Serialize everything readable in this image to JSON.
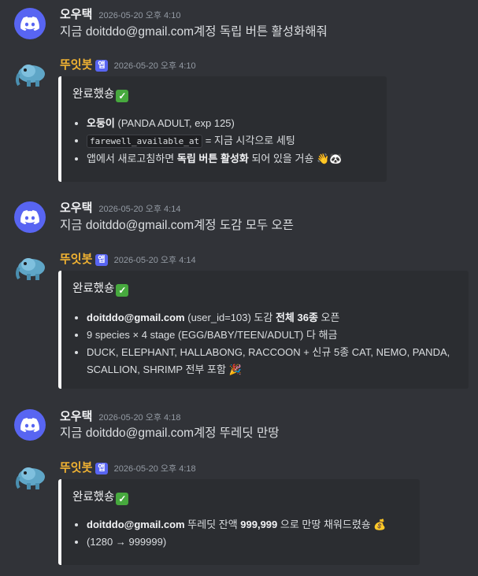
{
  "messages": [
    {
      "author": "오우택",
      "time": "2026-05-20 오후 4:10",
      "text": "지금 doitddo@gmail.com계정 독립 버튼 활성화해줘"
    },
    {
      "author": "뚜잇봇",
      "badge": "앱",
      "time": "2026-05-20 오후 4:10",
      "embed": {
        "title": "완료했숑",
        "items": [
          {
            "bold": "오둥이",
            "rest": " (PANDA ADULT, exp 125)"
          },
          {
            "code": "farewell_available_at",
            "rest": " = 지금 시각으로 세팅"
          },
          {
            "pre": "앱에서 새로고침하면 ",
            "bold": "독립 버튼 활성화",
            "rest": " 되어 있을 거숑 👋🐼"
          }
        ]
      }
    },
    {
      "author": "오우택",
      "time": "2026-05-20 오후 4:14",
      "text": "지금 doitddo@gmail.com계정 도감 모두 오픈"
    },
    {
      "author": "뚜잇봇",
      "badge": "앱",
      "time": "2026-05-20 오후 4:14",
      "embed": {
        "title": "완료했숑",
        "items": [
          {
            "bold": "doitddo@gmail.com",
            "rest": " (user_id=103) 도감 ",
            "bold2": "전체 36종",
            "rest2": " 오픈"
          },
          {
            "rest": "9 species × 4 stage (EGG/BABY/TEEN/ADULT) 다 해금"
          },
          {
            "rest": "DUCK, ELEPHANT, HALLABONG, RACCOON + 신규 5종 CAT, NEMO, PANDA, SCALLION, SHRIMP 전부 포함 🎉"
          }
        ]
      }
    },
    {
      "author": "오우택",
      "time": "2026-05-20 오후 4:18",
      "text": "지금 doitddo@gmail.com계정 뚜레딧 만땅"
    },
    {
      "author": "뚜잇봇",
      "badge": "앱",
      "time": "2026-05-20 오후 4:18",
      "embed": {
        "title": "완료했숑",
        "items": [
          {
            "bold": "doitddo@gmail.com",
            "rest": " 뚜레딧 잔액 ",
            "bold2": "999,999",
            "rest2": " 으로 만땅 채워드렸숑 💰"
          },
          {
            "rest": "(1280 → 999999)"
          }
        ]
      }
    }
  ],
  "icons": {
    "user_avatar": "discord-logo-icon",
    "bot_avatar": "elephant-avatar-icon",
    "check": "check-mark-icon"
  },
  "colors": {
    "background": "#313338",
    "embed": "#2b2d31",
    "blurple": "#5865f2",
    "bot_name": "#f0b232"
  }
}
